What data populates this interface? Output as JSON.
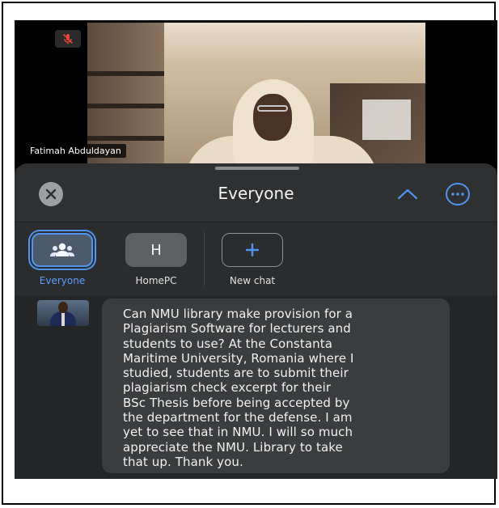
{
  "video": {
    "participant_name": "Fatimah Abduldayan",
    "mic_state": "muted"
  },
  "chat": {
    "header_title": "Everyone",
    "icons": {
      "close": "close-icon",
      "collapse": "chevron-up-icon",
      "more": "more-options-icon",
      "mic": "mic-off-icon",
      "group": "group-icon",
      "add": "plus-icon"
    },
    "recipients": [
      {
        "label": "Everyone",
        "initial": "",
        "selected": true
      },
      {
        "label": "HomePC",
        "initial": "H",
        "selected": false
      },
      {
        "label": "New chat",
        "initial": "+",
        "selected": false
      }
    ],
    "message": {
      "text": "Can NMU library make provision for a\nPlagiarism Software for lecturers and\nstudents to use? At the Constanta\nMaritime University, Romania where I\nstudied, students are to submit their\nplagiarism check excerpt for their\nBSc Thesis before being accepted by\nthe department for the defense. I am\nyet to see that in NMU. I will so much\nappreciate the NMU. Library to take\nthat up. Thank you."
    }
  },
  "colors": {
    "accent": "#4f95ee",
    "panel": "#2e3032",
    "bubble": "#3a3c3e",
    "mic_muted": "#e0453a"
  }
}
